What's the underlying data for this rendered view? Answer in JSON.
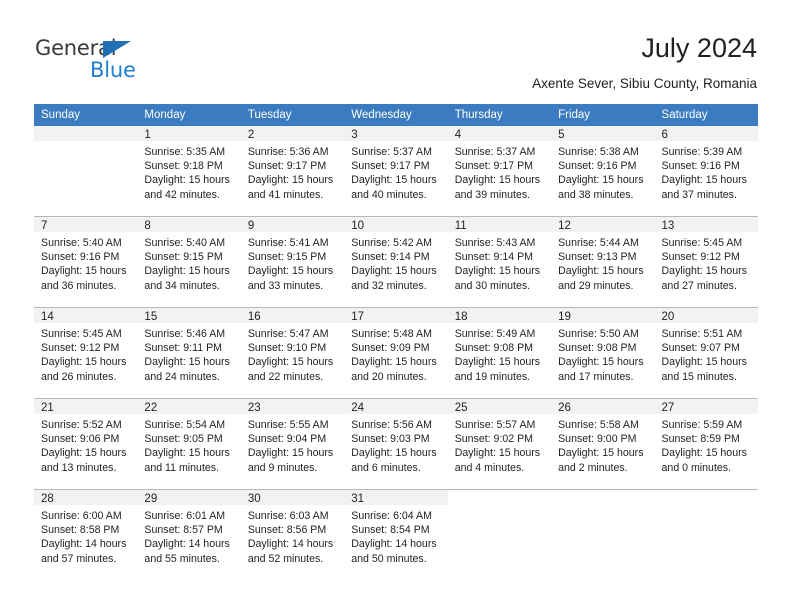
{
  "logo": {
    "word_one": "General",
    "word_two": "Blue",
    "triangle_icon": "triangle-icon",
    "color_dark": "#3a3a3a",
    "color_blue": "#1f7fd0"
  },
  "header": {
    "title": "July 2024",
    "subtitle": "Axente Sever, Sibiu County, Romania",
    "header_bg": "#3b7bbf",
    "daynum_bg": "#f2f2f2"
  },
  "weekdays": [
    "Sunday",
    "Monday",
    "Tuesday",
    "Wednesday",
    "Thursday",
    "Friday",
    "Saturday"
  ],
  "labels": {
    "sunrise": "Sunrise:",
    "sunset": "Sunset:",
    "daylight": "Daylight:"
  },
  "weeks": [
    [
      {
        "day": "",
        "sunrise": "",
        "sunset": "",
        "daylight_line1": "",
        "daylight_line2": ""
      },
      {
        "day": "1",
        "sunrise": "Sunrise: 5:35 AM",
        "sunset": "Sunset: 9:18 PM",
        "daylight_line1": "Daylight: 15 hours",
        "daylight_line2": "and 42 minutes."
      },
      {
        "day": "2",
        "sunrise": "Sunrise: 5:36 AM",
        "sunset": "Sunset: 9:17 PM",
        "daylight_line1": "Daylight: 15 hours",
        "daylight_line2": "and 41 minutes."
      },
      {
        "day": "3",
        "sunrise": "Sunrise: 5:37 AM",
        "sunset": "Sunset: 9:17 PM",
        "daylight_line1": "Daylight: 15 hours",
        "daylight_line2": "and 40 minutes."
      },
      {
        "day": "4",
        "sunrise": "Sunrise: 5:37 AM",
        "sunset": "Sunset: 9:17 PM",
        "daylight_line1": "Daylight: 15 hours",
        "daylight_line2": "and 39 minutes."
      },
      {
        "day": "5",
        "sunrise": "Sunrise: 5:38 AM",
        "sunset": "Sunset: 9:16 PM",
        "daylight_line1": "Daylight: 15 hours",
        "daylight_line2": "and 38 minutes."
      },
      {
        "day": "6",
        "sunrise": "Sunrise: 5:39 AM",
        "sunset": "Sunset: 9:16 PM",
        "daylight_line1": "Daylight: 15 hours",
        "daylight_line2": "and 37 minutes."
      }
    ],
    [
      {
        "day": "7",
        "sunrise": "Sunrise: 5:40 AM",
        "sunset": "Sunset: 9:16 PM",
        "daylight_line1": "Daylight: 15 hours",
        "daylight_line2": "and 36 minutes."
      },
      {
        "day": "8",
        "sunrise": "Sunrise: 5:40 AM",
        "sunset": "Sunset: 9:15 PM",
        "daylight_line1": "Daylight: 15 hours",
        "daylight_line2": "and 34 minutes."
      },
      {
        "day": "9",
        "sunrise": "Sunrise: 5:41 AM",
        "sunset": "Sunset: 9:15 PM",
        "daylight_line1": "Daylight: 15 hours",
        "daylight_line2": "and 33 minutes."
      },
      {
        "day": "10",
        "sunrise": "Sunrise: 5:42 AM",
        "sunset": "Sunset: 9:14 PM",
        "daylight_line1": "Daylight: 15 hours",
        "daylight_line2": "and 32 minutes."
      },
      {
        "day": "11",
        "sunrise": "Sunrise: 5:43 AM",
        "sunset": "Sunset: 9:14 PM",
        "daylight_line1": "Daylight: 15 hours",
        "daylight_line2": "and 30 minutes."
      },
      {
        "day": "12",
        "sunrise": "Sunrise: 5:44 AM",
        "sunset": "Sunset: 9:13 PM",
        "daylight_line1": "Daylight: 15 hours",
        "daylight_line2": "and 29 minutes."
      },
      {
        "day": "13",
        "sunrise": "Sunrise: 5:45 AM",
        "sunset": "Sunset: 9:12 PM",
        "daylight_line1": "Daylight: 15 hours",
        "daylight_line2": "and 27 minutes."
      }
    ],
    [
      {
        "day": "14",
        "sunrise": "Sunrise: 5:45 AM",
        "sunset": "Sunset: 9:12 PM",
        "daylight_line1": "Daylight: 15 hours",
        "daylight_line2": "and 26 minutes."
      },
      {
        "day": "15",
        "sunrise": "Sunrise: 5:46 AM",
        "sunset": "Sunset: 9:11 PM",
        "daylight_line1": "Daylight: 15 hours",
        "daylight_line2": "and 24 minutes."
      },
      {
        "day": "16",
        "sunrise": "Sunrise: 5:47 AM",
        "sunset": "Sunset: 9:10 PM",
        "daylight_line1": "Daylight: 15 hours",
        "daylight_line2": "and 22 minutes."
      },
      {
        "day": "17",
        "sunrise": "Sunrise: 5:48 AM",
        "sunset": "Sunset: 9:09 PM",
        "daylight_line1": "Daylight: 15 hours",
        "daylight_line2": "and 20 minutes."
      },
      {
        "day": "18",
        "sunrise": "Sunrise: 5:49 AM",
        "sunset": "Sunset: 9:08 PM",
        "daylight_line1": "Daylight: 15 hours",
        "daylight_line2": "and 19 minutes."
      },
      {
        "day": "19",
        "sunrise": "Sunrise: 5:50 AM",
        "sunset": "Sunset: 9:08 PM",
        "daylight_line1": "Daylight: 15 hours",
        "daylight_line2": "and 17 minutes."
      },
      {
        "day": "20",
        "sunrise": "Sunrise: 5:51 AM",
        "sunset": "Sunset: 9:07 PM",
        "daylight_line1": "Daylight: 15 hours",
        "daylight_line2": "and 15 minutes."
      }
    ],
    [
      {
        "day": "21",
        "sunrise": "Sunrise: 5:52 AM",
        "sunset": "Sunset: 9:06 PM",
        "daylight_line1": "Daylight: 15 hours",
        "daylight_line2": "and 13 minutes."
      },
      {
        "day": "22",
        "sunrise": "Sunrise: 5:54 AM",
        "sunset": "Sunset: 9:05 PM",
        "daylight_line1": "Daylight: 15 hours",
        "daylight_line2": "and 11 minutes."
      },
      {
        "day": "23",
        "sunrise": "Sunrise: 5:55 AM",
        "sunset": "Sunset: 9:04 PM",
        "daylight_line1": "Daylight: 15 hours",
        "daylight_line2": "and 9 minutes."
      },
      {
        "day": "24",
        "sunrise": "Sunrise: 5:56 AM",
        "sunset": "Sunset: 9:03 PM",
        "daylight_line1": "Daylight: 15 hours",
        "daylight_line2": "and 6 minutes."
      },
      {
        "day": "25",
        "sunrise": "Sunrise: 5:57 AM",
        "sunset": "Sunset: 9:02 PM",
        "daylight_line1": "Daylight: 15 hours",
        "daylight_line2": "and 4 minutes."
      },
      {
        "day": "26",
        "sunrise": "Sunrise: 5:58 AM",
        "sunset": "Sunset: 9:00 PM",
        "daylight_line1": "Daylight: 15 hours",
        "daylight_line2": "and 2 minutes."
      },
      {
        "day": "27",
        "sunrise": "Sunrise: 5:59 AM",
        "sunset": "Sunset: 8:59 PM",
        "daylight_line1": "Daylight: 15 hours",
        "daylight_line2": "and 0 minutes."
      }
    ],
    [
      {
        "day": "28",
        "sunrise": "Sunrise: 6:00 AM",
        "sunset": "Sunset: 8:58 PM",
        "daylight_line1": "Daylight: 14 hours",
        "daylight_line2": "and 57 minutes."
      },
      {
        "day": "29",
        "sunrise": "Sunrise: 6:01 AM",
        "sunset": "Sunset: 8:57 PM",
        "daylight_line1": "Daylight: 14 hours",
        "daylight_line2": "and 55 minutes."
      },
      {
        "day": "30",
        "sunrise": "Sunrise: 6:03 AM",
        "sunset": "Sunset: 8:56 PM",
        "daylight_line1": "Daylight: 14 hours",
        "daylight_line2": "and 52 minutes."
      },
      {
        "day": "31",
        "sunrise": "Sunrise: 6:04 AM",
        "sunset": "Sunset: 8:54 PM",
        "daylight_line1": "Daylight: 14 hours",
        "daylight_line2": "and 50 minutes."
      },
      {
        "day": "",
        "sunrise": "",
        "sunset": "",
        "daylight_line1": "",
        "daylight_line2": ""
      },
      {
        "day": "",
        "sunrise": "",
        "sunset": "",
        "daylight_line1": "",
        "daylight_line2": ""
      },
      {
        "day": "",
        "sunrise": "",
        "sunset": "",
        "daylight_line1": "",
        "daylight_line2": ""
      }
    ]
  ]
}
